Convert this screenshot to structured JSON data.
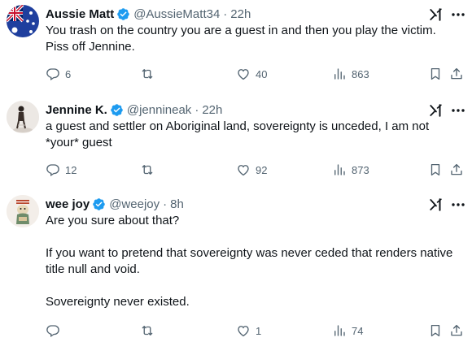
{
  "tweets": [
    {
      "name": "Aussie Matt",
      "handle": "@AussieMatt34",
      "separator": "·",
      "time": "22h",
      "lines": [
        "You trash on the country you are a guest in and then you play the victim.",
        "Piss off Jennine."
      ],
      "replies": "6",
      "reposts": "",
      "likes": "40",
      "views": "863"
    },
    {
      "name": "Jennine K.",
      "handle": "@jennineak",
      "separator": "·",
      "time": "22h",
      "lines": [
        "a guest and settler on Aboriginal land, sovereignty is unceded, I am not",
        "*your* guest"
      ],
      "replies": "12",
      "reposts": "",
      "likes": "92",
      "views": "873"
    },
    {
      "name": "wee joy",
      "handle": "@weejoy",
      "separator": "·",
      "time": "8h",
      "lines": [
        "Are you sure about that?",
        "",
        "If you want to pretend that sovereignty was never ceded that renders native",
        "title null and void.",
        "",
        "Sovereignty never existed."
      ],
      "replies": "",
      "reposts": "",
      "likes": "1",
      "views": "74"
    }
  ],
  "icons": {
    "verified": "verified-badge-icon",
    "grok": "grok-icon",
    "more": "more-icon",
    "reply": "reply-icon",
    "repost": "repost-icon",
    "like": "like-icon",
    "views": "views-icon",
    "bookmark": "bookmark-icon",
    "share": "share-icon"
  },
  "colors": {
    "verified": "#1d9bf0",
    "secondary_text": "#536471",
    "primary_text": "#0f1419"
  }
}
